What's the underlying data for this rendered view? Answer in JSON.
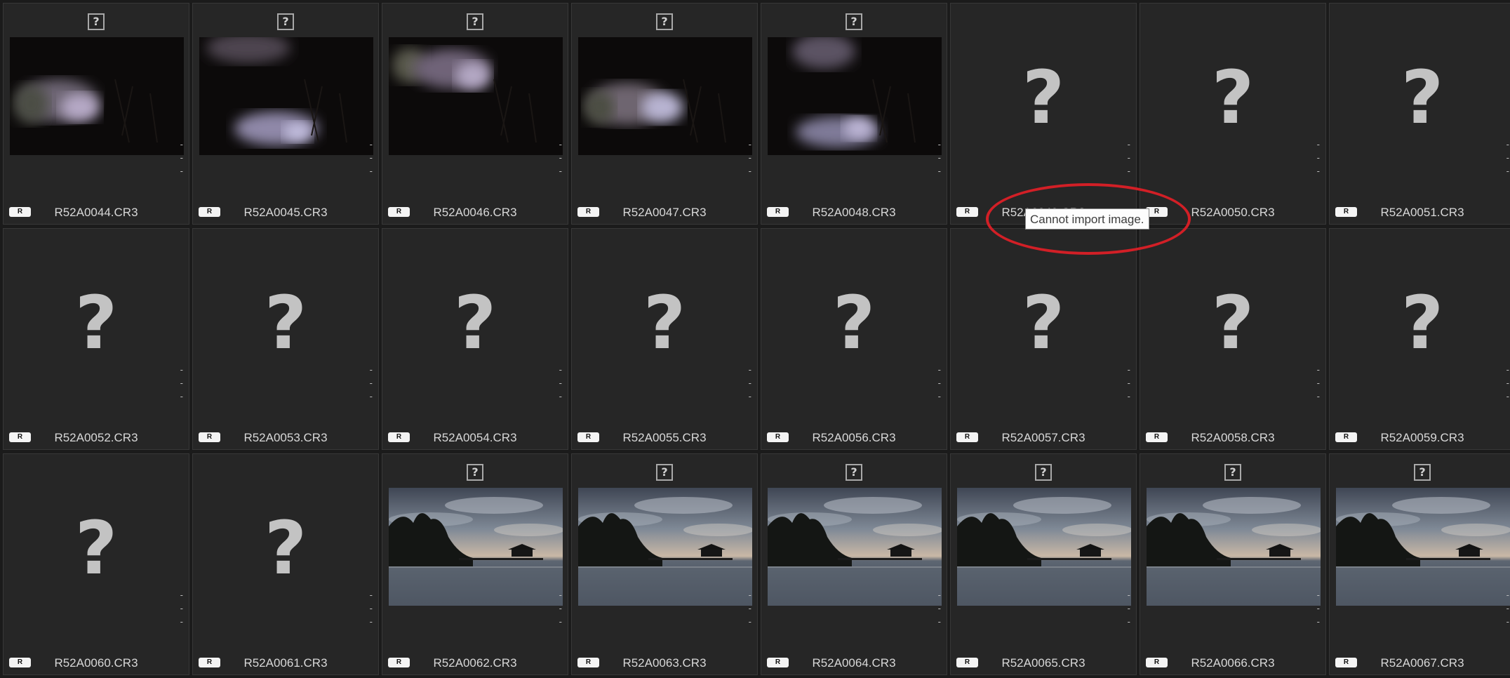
{
  "tooltip": {
    "text": "Cannot import image."
  },
  "raw_badge_label": "R",
  "info_dash": "-",
  "unknown_glyph": "?",
  "tiles": [
    {
      "name": "R52A0044.CR3",
      "kind": "night"
    },
    {
      "name": "R52A0045.CR3",
      "kind": "night"
    },
    {
      "name": "R52A0046.CR3",
      "kind": "night"
    },
    {
      "name": "R52A0047.CR3",
      "kind": "night"
    },
    {
      "name": "R52A0048.CR3",
      "kind": "night"
    },
    {
      "name": "R52A0049.CR3",
      "kind": "missing"
    },
    {
      "name": "R52A0050.CR3",
      "kind": "missing"
    },
    {
      "name": "R52A0051.CR3",
      "kind": "missing"
    },
    {
      "name": "R52A0052.CR3",
      "kind": "missing"
    },
    {
      "name": "R52A0053.CR3",
      "kind": "missing"
    },
    {
      "name": "R52A0054.CR3",
      "kind": "missing"
    },
    {
      "name": "R52A0055.CR3",
      "kind": "missing"
    },
    {
      "name": "R52A0056.CR3",
      "kind": "missing"
    },
    {
      "name": "R52A0057.CR3",
      "kind": "missing"
    },
    {
      "name": "R52A0058.CR3",
      "kind": "missing"
    },
    {
      "name": "R52A0059.CR3",
      "kind": "missing"
    },
    {
      "name": "R52A0060.CR3",
      "kind": "missing"
    },
    {
      "name": "R52A0061.CR3",
      "kind": "missing"
    },
    {
      "name": "R52A0062.CR3",
      "kind": "sunset"
    },
    {
      "name": "R52A0063.CR3",
      "kind": "sunset"
    },
    {
      "name": "R52A0064.CR3",
      "kind": "sunset"
    },
    {
      "name": "R52A0065.CR3",
      "kind": "sunset"
    },
    {
      "name": "R52A0066.CR3",
      "kind": "sunset"
    },
    {
      "name": "R52A0067.CR3",
      "kind": "sunset"
    }
  ],
  "colors": {
    "tile_bg": "#262626",
    "annotation_ring": "#d21f26",
    "tooltip_bg": "#fdfdfd"
  }
}
